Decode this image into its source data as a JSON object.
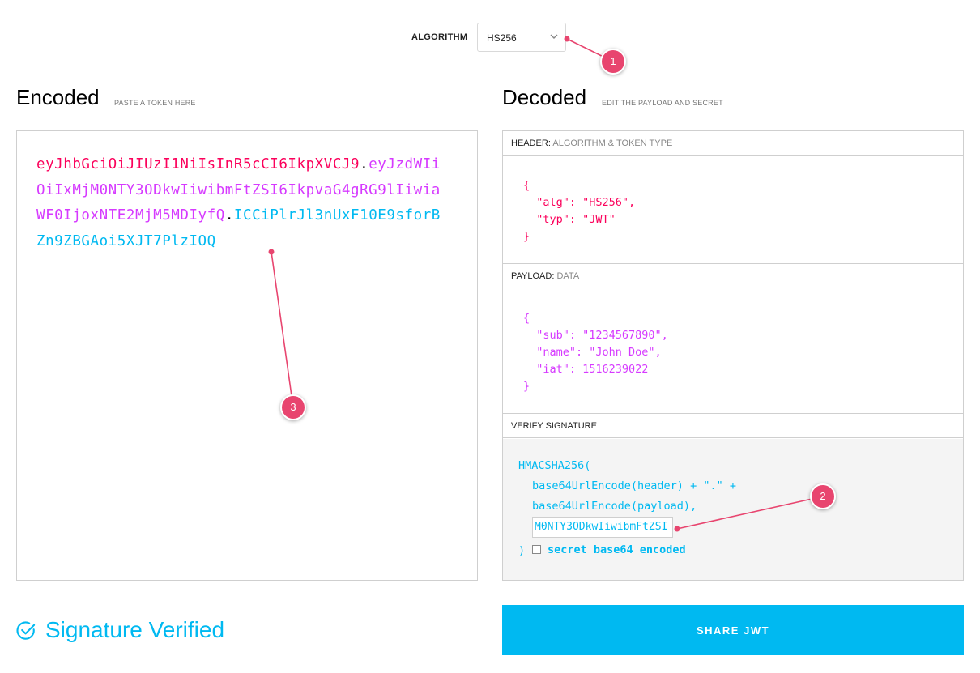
{
  "algorithm": {
    "label": "ALGORITHM",
    "selected": "HS256"
  },
  "encoded": {
    "title": "Encoded",
    "subtitle": "PASTE A TOKEN HERE",
    "token_header": "eyJhbGciOiJIUzI1NiIsInR5cCI6IkpXVCJ9",
    "token_payload": "eyJzdWIiOiIxMjM0NTY3ODkwIiwibmFtZSI6IkpvaG4gRG9lIiwiaWF0IjoxNTE2MjM5MDIyfQ",
    "token_signature": "ICCiPlrJl3nUxF10E9sforBZn9ZBGAoi5XJT7PlzIOQ",
    "dot": "."
  },
  "decoded": {
    "title": "Decoded",
    "subtitle": "EDIT THE PAYLOAD AND SECRET",
    "header_section": {
      "label": "HEADER:",
      "sublabel": "ALGORITHM & TOKEN TYPE",
      "json": "{\n  \"alg\": \"HS256\",\n  \"typ\": \"JWT\"\n}"
    },
    "payload_section": {
      "label": "PAYLOAD:",
      "sublabel": "DATA",
      "json": "{\n  \"sub\": \"1234567890\",\n  \"name\": \"John Doe\",\n  \"iat\": 1516239022\n}"
    },
    "verify_section": {
      "label": "VERIFY SIGNATURE",
      "line1": "HMACSHA256(",
      "line2": "base64UrlEncode(header) + \".\" +",
      "line3": "base64UrlEncode(payload),",
      "secret_value": "M0NTY3ODkwIiwibmFtZSI",
      "close": ")",
      "checkbox_label": "secret base64 encoded"
    }
  },
  "status": {
    "text": "Signature Verified"
  },
  "share_button": {
    "label": "SHARE JWT"
  },
  "callouts": [
    "1",
    "2",
    "3"
  ],
  "colors": {
    "header": "#fb015b",
    "payload": "#d63aff",
    "signature": "#00b9f1",
    "callout": "#e8456f"
  }
}
